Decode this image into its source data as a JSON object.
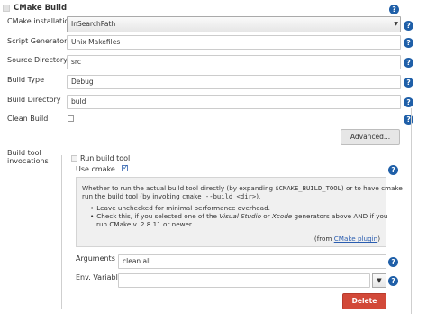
{
  "header": {
    "title": "CMake Build"
  },
  "fields": {
    "cmake_installation": {
      "label": "CMake installation",
      "value": "InSearchPath"
    },
    "script_generator": {
      "label": "Script Generator",
      "value": "Unix Makefiles"
    },
    "source_directory": {
      "label": "Source Directory",
      "value": "src"
    },
    "build_type": {
      "label": "Build Type",
      "value": "Debug"
    },
    "build_directory": {
      "label": "Build Directory",
      "value": "buld"
    },
    "clean_build": {
      "label": "Clean Build",
      "checked": false
    }
  },
  "advanced_button": {
    "label": "Advanced..."
  },
  "build_tool": {
    "section_label_line1": "Build tool",
    "section_label_line2": "invocations",
    "run_build_tool": {
      "label": "Run build tool",
      "checked": false
    },
    "use_cmake": {
      "label": "Use cmake",
      "checked": true
    },
    "help_box": {
      "intro_part1": "Whether to run the actual build tool directly (by expanding ",
      "intro_var": "$CMAKE_BUILD_TOOL",
      "intro_part2": ") or to have cmake",
      "intro_line2_part1": "run the build tool (by invoking ",
      "intro_code": "cmake --build <dir>",
      "intro_line2_part2": ").",
      "bullet1": "Leave unchecked for minimal performance overhead.",
      "bullet2_part1": "Check this, if you selected one of the ",
      "bullet2_vs": "Visual Studio",
      "bullet2_part2": " or ",
      "bullet2_xcode": "Xcode",
      "bullet2_part3": " generators above AND if you",
      "bullet2_line2": "run CMake v. 2.8.11 or newer.",
      "from_prefix": "(from ",
      "from_link": "CMake plugin",
      "from_suffix": ")"
    },
    "arguments": {
      "label": "Arguments",
      "value": "clean all"
    },
    "env_variables": {
      "label": "Env. Variables",
      "value": ""
    },
    "delete_button": {
      "label": "Delete"
    }
  },
  "icons": {
    "help": "?",
    "collapse_arrow": "▼",
    "dropdown_arrow": "▼"
  },
  "colors": {
    "delete_button": "#d24939",
    "help_icon": "#1f5fa8",
    "advanced_button": "#e6e6e6",
    "help_box_bg": "#f0f0f0"
  }
}
